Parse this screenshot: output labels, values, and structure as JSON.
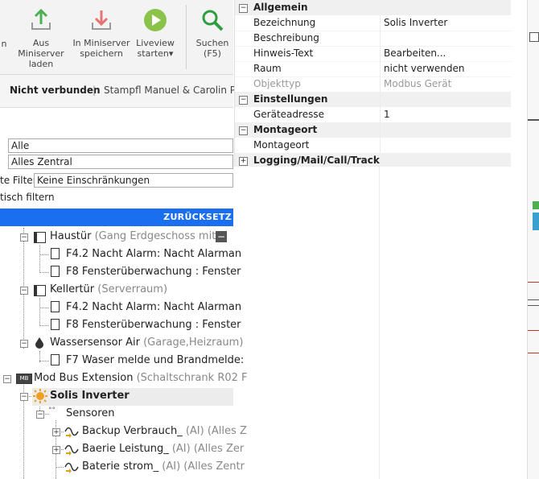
{
  "ribbon": {
    "cut_label": "n",
    "download_label": "Aus Miniserver laden",
    "upload_label": "In Miniserver speichern",
    "liveview_label": "Liveview starten",
    "liveview_caret": "▾",
    "search_label": "Suchen",
    "search_key": "(F5)"
  },
  "status": {
    "connection": "Nicht verbunden",
    "separator": "|",
    "project": "Stampfl Manuel & Carolin Pro"
  },
  "filters": {
    "room_value": "Alle",
    "category_value": "Alles Zentral",
    "filter_label": "te Filter",
    "filter_value": "Keine Einschränkungen",
    "auto_filter_label": "tisch filtern",
    "reset_label": "ZURÜCKSETZ"
  },
  "tree": [
    {
      "label": "Haustür",
      "sub": "(Gang Erdgeschoss mit S"
    },
    {
      "label": "F4.2 Nacht Alarm: Nacht Alarman",
      "sub": ""
    },
    {
      "label": "F8  Fensterüberwachung : Fenster",
      "sub": ""
    },
    {
      "label": "Kellertür",
      "sub": "(Serverraum)"
    },
    {
      "label": "F4.2 Nacht Alarm: Nacht Alarman",
      "sub": ""
    },
    {
      "label": "F8  Fensterüberwachung : Fenster",
      "sub": ""
    },
    {
      "label": "Wassersensor Air",
      "sub": "(Garage,Heizraum)"
    },
    {
      "label": "F7 Waser melde und Brandmelde:",
      "sub": ""
    },
    {
      "label": "Mod Bus Extension",
      "sub": "(Schaltschrank R02 F"
    },
    {
      "label": "Solis Inverter",
      "sub": ""
    },
    {
      "label": "Sensoren",
      "sub": ""
    },
    {
      "label": "Backup Verbrauch_",
      "sub": "(AI) (Alles Z"
    },
    {
      "label": "Baerie Leistung_",
      "sub": "(AI) (Alles Zer"
    },
    {
      "label": "Baterie strom_",
      "sub": "(AI) (Alles Zentr"
    }
  ],
  "properties": {
    "cat_general": "Allgemein",
    "name_key": "Bezeichnung",
    "name_val": "Solis Inverter",
    "desc_key": "Beschreibung",
    "desc_val": "",
    "hint_key": "Hinweis-Text",
    "hint_val": "Bearbeiten...",
    "room_key": "Raum",
    "room_val": "nicht verwenden",
    "type_key": "Objekttyp",
    "type_val": "Modbus Gerät",
    "cat_settings": "Einstellungen",
    "addr_key": "Geräteadresse",
    "addr_val": "1",
    "cat_mount": "Montageort",
    "mount_key": "Montageort",
    "mount_val": "",
    "cat_logging": "Logging/Mail/Call/Track"
  },
  "colors": {
    "accent": "#1a6ff0",
    "download": "#4caf50",
    "upload": "#e57373",
    "liveview": "#8bc34a",
    "search": "#2e9e3e"
  }
}
